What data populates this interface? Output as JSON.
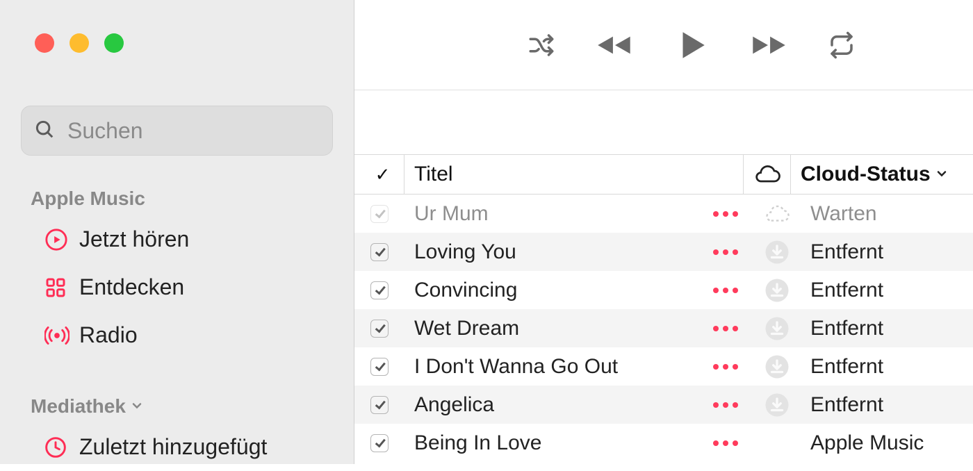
{
  "sidebar": {
    "search_placeholder": "Suchen",
    "section1_label": "Apple Music",
    "items1": [
      {
        "label": "Jetzt hören"
      },
      {
        "label": "Entdecken"
      },
      {
        "label": "Radio"
      }
    ],
    "section2_label": "Mediathek",
    "items2": [
      {
        "label": "Zuletzt hinzugefügt"
      }
    ]
  },
  "columns": {
    "check": "✓",
    "title": "Titel",
    "status": "Cloud-Status"
  },
  "rows": [
    {
      "checked": true,
      "faint": true,
      "title": "Ur Mum",
      "cloud": "dotted",
      "status": "Warten",
      "status_faint": true
    },
    {
      "checked": true,
      "faint": false,
      "title": "Loving You",
      "cloud": "dl",
      "status": "Entfernt",
      "status_faint": false
    },
    {
      "checked": true,
      "faint": false,
      "title": "Convincing",
      "cloud": "dl",
      "status": "Entfernt",
      "status_faint": false
    },
    {
      "checked": true,
      "faint": false,
      "title": "Wet Dream",
      "cloud": "dl",
      "status": "Entfernt",
      "status_faint": false
    },
    {
      "checked": true,
      "faint": false,
      "title": "I Don't Wanna Go Out",
      "cloud": "dl",
      "status": "Entfernt",
      "status_faint": false
    },
    {
      "checked": true,
      "faint": false,
      "title": "Angelica",
      "cloud": "dl",
      "status": "Entfernt",
      "status_faint": false
    },
    {
      "checked": true,
      "faint": false,
      "title": "Being In Love",
      "cloud": "none",
      "status": "Apple Music",
      "status_faint": false
    }
  ]
}
